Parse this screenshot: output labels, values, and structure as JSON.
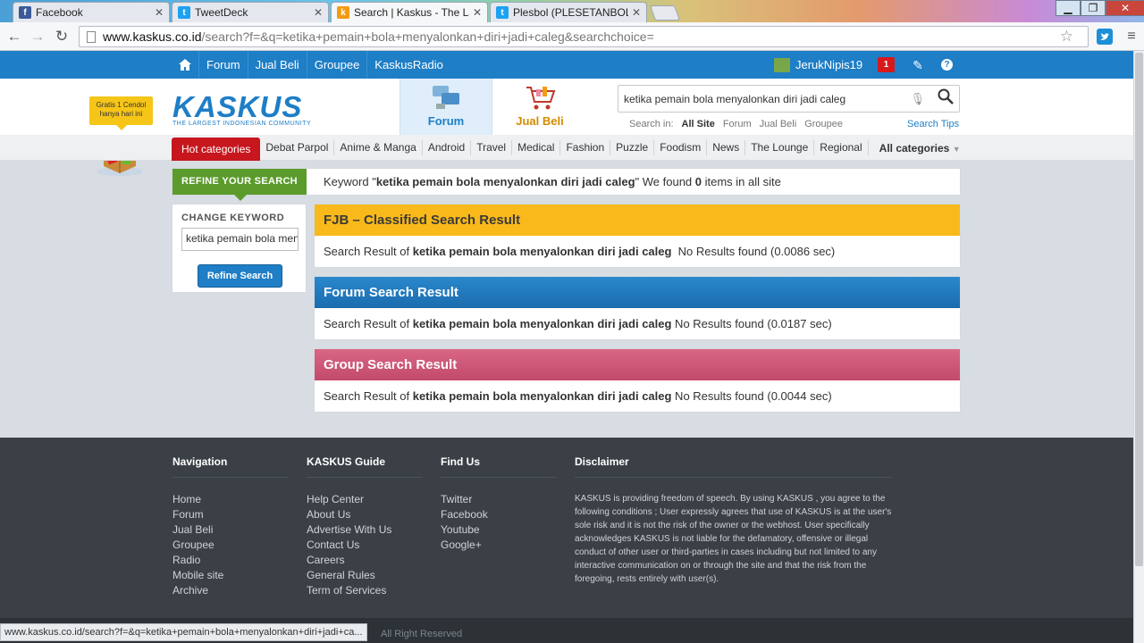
{
  "browser": {
    "tabs": [
      {
        "title": "Facebook",
        "icon": "facebook-icon",
        "color": "#3b5998"
      },
      {
        "title": "TweetDeck",
        "icon": "twitter-icon",
        "color": "#1da1f2"
      },
      {
        "title": "Search | Kaskus - The Larg",
        "icon": "kaskus-icon",
        "color": "#f39c12"
      },
      {
        "title": "Plesbol (PLESETANBOLA)",
        "icon": "twitter-icon",
        "color": "#1da1f2"
      }
    ],
    "url_host": "www.kaskus.co.id",
    "url_path": "/search?f=&q=ketika+pemain+bola+menyalonkan+diri+jadi+caleg&searchchoice="
  },
  "topbar": {
    "nav": [
      "Forum",
      "Jual Beli",
      "Groupee",
      "KaskusRadio"
    ],
    "username": "JerukNipis19",
    "notif_count": "1"
  },
  "header": {
    "promo": "Gratis 1 Cendol hanya hari ini",
    "logo_text": "KASKUS",
    "logo_sub": "THE LARGEST INDONESIAN COMMUNITY",
    "tab_forum": "Forum",
    "tab_jualbeli": "Jual Beli",
    "search_value": "ketika pemain bola menyalonkan diri jadi caleg",
    "search_in_label": "Search in:",
    "search_in": [
      "All Site",
      "Forum",
      "Jual Beli",
      "Groupee"
    ],
    "search_tips": "Search Tips"
  },
  "categories": {
    "hot": "Hot categories",
    "items": [
      "Debat Parpol",
      "Anime & Manga",
      "Android",
      "Travel",
      "Medical",
      "Fashion",
      "Puzzle",
      "Foodism",
      "News",
      "The Lounge",
      "Regional"
    ],
    "all": "All categories"
  },
  "refine": {
    "label": "REFINE YOUR SEARCH",
    "msg_pre": "Keyword \"",
    "keyword": "ketika pemain bola menyalonkan diri jadi caleg",
    "msg_mid": "\" We found ",
    "count": "0",
    "msg_post": " items in all site"
  },
  "sidebar": {
    "label": "CHANGE KEYWORD",
    "input_value": "ketika pemain bola menyalonkan diri jadi caleg",
    "button": "Refine Search"
  },
  "results": [
    {
      "title": "FJB – Classified Search Result",
      "prefix": "Search Result of ",
      "keyword": "ketika pemain bola menyalonkan diri jadi caleg",
      "suffix": "  No Results found (0.0086 sec)"
    },
    {
      "title": "Forum Search Result",
      "prefix": "Search Result of ",
      "keyword": "ketika pemain bola menyalonkan diri jadi caleg",
      "suffix": " No Results found (0.0187 sec)"
    },
    {
      "title": "Group Search Result",
      "prefix": "Search Result of ",
      "keyword": "ketika pemain bola menyalonkan diri jadi caleg",
      "suffix": " No Results found (0.0044 sec)"
    }
  ],
  "footer": {
    "navigation": {
      "title": "Navigation",
      "items": [
        "Home",
        "Forum",
        "Jual Beli",
        "Groupee",
        "Radio",
        "Mobile site",
        "Archive"
      ]
    },
    "guide": {
      "title": "KASKUS Guide",
      "items": [
        "Help Center",
        "About Us",
        "Advertise With Us",
        "Contact Us",
        "Careers",
        "General Rules",
        "Term of Services"
      ]
    },
    "findus": {
      "title": "Find Us",
      "items": [
        "Twitter",
        "Facebook",
        "Youtube",
        "Google+"
      ]
    },
    "disclaimer": {
      "title": "Disclaimer",
      "text": "KASKUS is providing freedom of speech. By using KASKUS , you agree to the following conditions ; User expressly agrees that use of KASKUS is at the user's sole risk and it is not the risk of the owner or the webhost. User specifically acknowledges KASKUS is not liable for the defamatory, offensive or illegal conduct of other user or third-parties in cases including but not limited to any interactive communication on or through the site and that the risk from the foregoing, rests entirely with user(s)."
    },
    "copyright": "All Right Reserved"
  },
  "statusbar": "www.kaskus.co.id/search?f=&q=ketika+pemain+bola+menyalonkan+diri+jadi+ca..."
}
